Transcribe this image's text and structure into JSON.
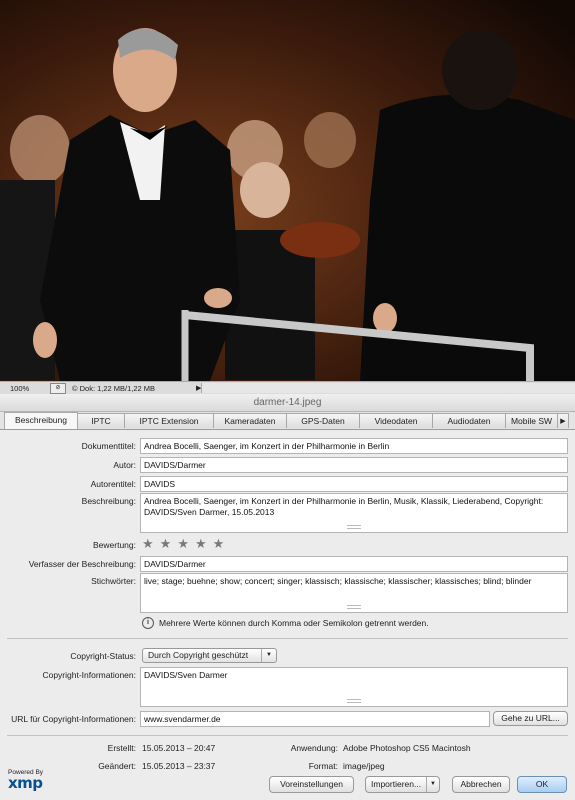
{
  "status_bar": {
    "zoom": "100%",
    "doc_info": "© Dok: 1,22 MB/1,22 MB",
    "arrow": "▶"
  },
  "window": {
    "title": "darmer-14.jpeg"
  },
  "tabs": [
    {
      "label": "Beschreibung",
      "active": true
    },
    {
      "label": "IPTC"
    },
    {
      "label": "IPTC Extension"
    },
    {
      "label": "Kameradaten"
    },
    {
      "label": "GPS-Daten"
    },
    {
      "label": "Videodaten"
    },
    {
      "label": "Audiodaten"
    },
    {
      "label": "Mobile SW"
    }
  ],
  "tabs_scroll_icon": "▶",
  "fields": {
    "dokumenttitel": {
      "label": "Dokumenttitel:",
      "value": "Andrea Bocelli, Saenger, im Konzert in der Philharmonie in Berlin"
    },
    "autor": {
      "label": "Autor:",
      "value": "DAVIDS/Darmer"
    },
    "autorentitel": {
      "label": "Autorentitel:",
      "value": "DAVIDS"
    },
    "beschreibung": {
      "label": "Beschreibung:",
      "value": "Andrea Bocelli, Saenger, im Konzert in der Philharmonie in Berlin, Musik, Klassik, Liederabend, Copyright: DAVIDS/Sven Darmer, 15.05.2013"
    },
    "bewertung": {
      "label": "Bewertung:",
      "stars_total": 5,
      "stars_filled": 0
    },
    "verfasser": {
      "label": "Verfasser der Beschreibung:",
      "value": "DAVIDS/Darmer"
    },
    "stichwoerter": {
      "label": "Stichwörter:",
      "value": "live; stage; buehne; show; concert; singer; klassisch; klassische; klassischer; klassisches; blind; blinder"
    },
    "hint": "Mehrere Werte können durch Komma oder Semikolon getrennt werden.",
    "copyright_status": {
      "label": "Copyright-Status:",
      "value": "Durch Copyright geschützt"
    },
    "copyright_info": {
      "label": "Copyright-Informationen:",
      "value": "DAVIDS/Sven Darmer"
    },
    "copyright_url": {
      "label": "URL für Copyright-Informationen:",
      "value": "www.svendarmer.de",
      "button": "Gehe zu URL..."
    }
  },
  "metadata": {
    "erstellt": {
      "label": "Erstellt:",
      "value": "15.05.2013 – 20:47"
    },
    "geaendert": {
      "label": "Geändert:",
      "value": "15.05.2013 – 23:37"
    },
    "anwendung": {
      "label": "Anwendung:",
      "value": "Adobe Photoshop CS5 Macintosh"
    },
    "format": {
      "label": "Format:",
      "value": "image/jpeg"
    }
  },
  "footer": {
    "powered_by": "Powered By",
    "logo": "xmp",
    "voreinstellungen": "Voreinstellungen",
    "importieren": "Importieren...",
    "abbrechen": "Abbrechen",
    "ok": "OK"
  },
  "colors": {
    "default_button": "#a9cdf2",
    "xmp_logo": "#0a4f8f"
  }
}
